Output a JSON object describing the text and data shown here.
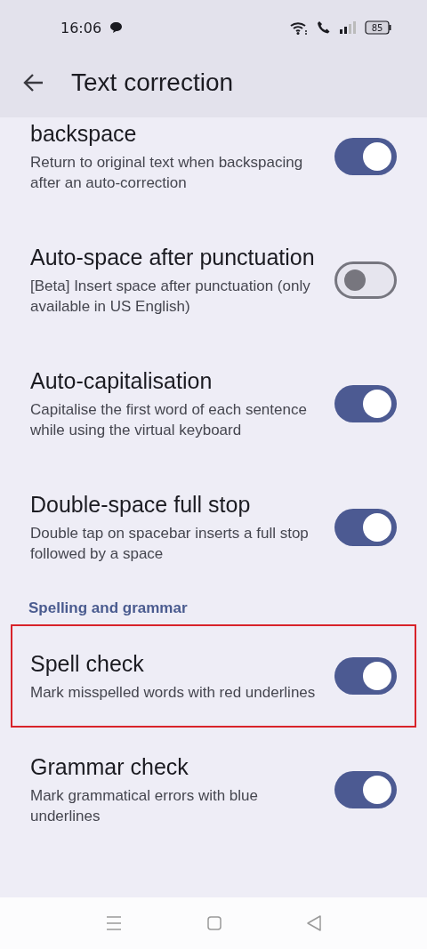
{
  "status_bar": {
    "time": "16:06",
    "battery": "85"
  },
  "header": {
    "title": "Text correction"
  },
  "settings": [
    {
      "kind": "toggle",
      "title": "backspace",
      "description": "Return to original text when backspacing after an auto-correction",
      "on": true,
      "highlighted": false
    },
    {
      "kind": "toggle",
      "title": "Auto-space after punctuation",
      "description": "[Beta] Insert space after punctuation (only available in US English)",
      "on": false,
      "highlighted": false
    },
    {
      "kind": "toggle",
      "title": "Auto-capitalisation",
      "description": "Capitalise the first word of each sentence while using the virtual keyboard",
      "on": true,
      "highlighted": false
    },
    {
      "kind": "toggle",
      "title": "Double-space full stop",
      "description": "Double tap on spacebar inserts a full stop followed by a space",
      "on": true,
      "highlighted": false
    },
    {
      "kind": "section",
      "title": "Spelling and grammar"
    },
    {
      "kind": "toggle",
      "title": "Spell check",
      "description": "Mark misspelled words with red underlines",
      "on": true,
      "highlighted": true
    },
    {
      "kind": "toggle",
      "title": "Grammar check",
      "description": "Mark grammatical errors with blue underlines",
      "on": true,
      "highlighted": false
    }
  ]
}
